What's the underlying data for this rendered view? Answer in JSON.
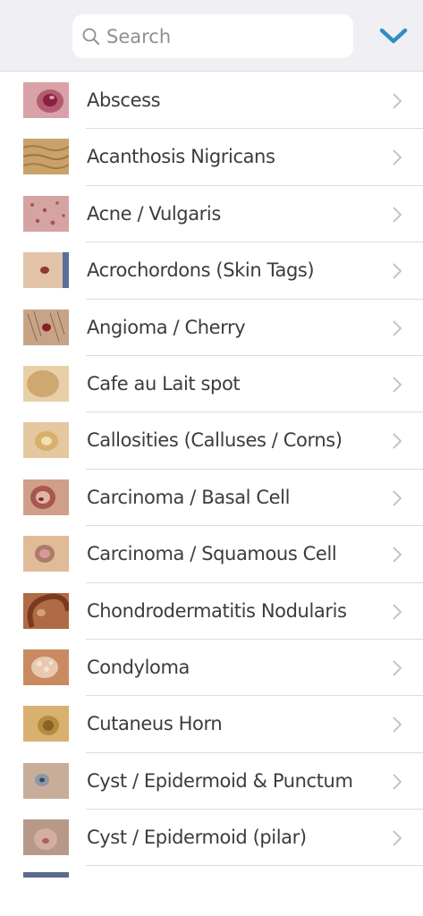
{
  "search": {
    "placeholder": "Search",
    "value": ""
  },
  "header": {
    "toggle_icon": "chevron-down-icon",
    "accent_color": "#2f8fc4"
  },
  "items": [
    {
      "label": "Abscess",
      "thumb": "abscess-thumbnail"
    },
    {
      "label": "Acanthosis Nigricans",
      "thumb": "acanthosis-nigricans-thumbnail"
    },
    {
      "label": "Acne / Vulgaris",
      "thumb": "acne-vulgaris-thumbnail"
    },
    {
      "label": "Acrochordons (Skin Tags)",
      "thumb": "acrochordons-thumbnail"
    },
    {
      "label": "Angioma / Cherry",
      "thumb": "angioma-cherry-thumbnail"
    },
    {
      "label": "Cafe au Lait spot",
      "thumb": "cafe-au-lait-thumbnail"
    },
    {
      "label": "Callosities (Calluses / Corns)",
      "thumb": "callosities-thumbnail"
    },
    {
      "label": "Carcinoma / Basal Cell",
      "thumb": "carcinoma-basal-cell-thumbnail"
    },
    {
      "label": "Carcinoma / Squamous Cell",
      "thumb": "carcinoma-squamous-cell-thumbnail"
    },
    {
      "label": "Chondrodermatitis Nodularis",
      "thumb": "chondrodermatitis-thumbnail"
    },
    {
      "label": "Condyloma",
      "thumb": "condyloma-thumbnail"
    },
    {
      "label": "Cutaneus Horn",
      "thumb": "cutaneus-horn-thumbnail"
    },
    {
      "label": "Cyst / Epidermoid & Punctum",
      "thumb": "cyst-epidermoid-punctum-thumbnail"
    },
    {
      "label": "Cyst / Epidermoid (pilar)",
      "thumb": "cyst-epidermoid-pilar-thumbnail"
    }
  ]
}
